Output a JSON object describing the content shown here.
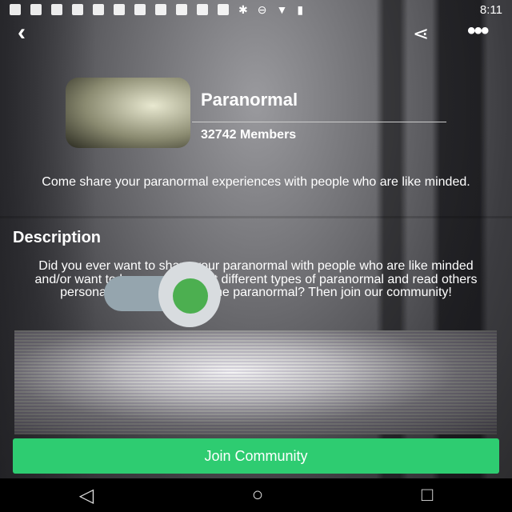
{
  "status_bar": {
    "time": "8:11",
    "icons": [
      "messages-icon",
      "facebook-icon",
      "facebook-icon",
      "facebook-icon",
      "facebook-icon",
      "notification-icon",
      "notification-icon",
      "notification-icon",
      "notification-icon",
      "blank-icon",
      "notification-icon",
      "bluetooth-icon",
      "do-not-disturb-icon",
      "wifi-icon",
      "no-sim-icon",
      "battery-charging-icon"
    ]
  },
  "header": {
    "back": "‹",
    "share": "⋖",
    "more": "•••"
  },
  "community": {
    "name": "Paranormal",
    "members": "32742 Members",
    "tagline": "Come share your paranormal experiences with people who are like minded."
  },
  "description": {
    "heading": "Description",
    "text": "Did you ever want to share your paranormal with people who are like minded and/or want to know more about different types of paranormal and read others personal experiences with the paranormal? Then join our community!"
  },
  "toggle": {
    "on": true,
    "color": "#4caf50"
  },
  "join_button": {
    "label": "Join Community",
    "color": "#2ecc71"
  },
  "nav": {
    "back": "◁",
    "home": "○",
    "recents": "□"
  }
}
